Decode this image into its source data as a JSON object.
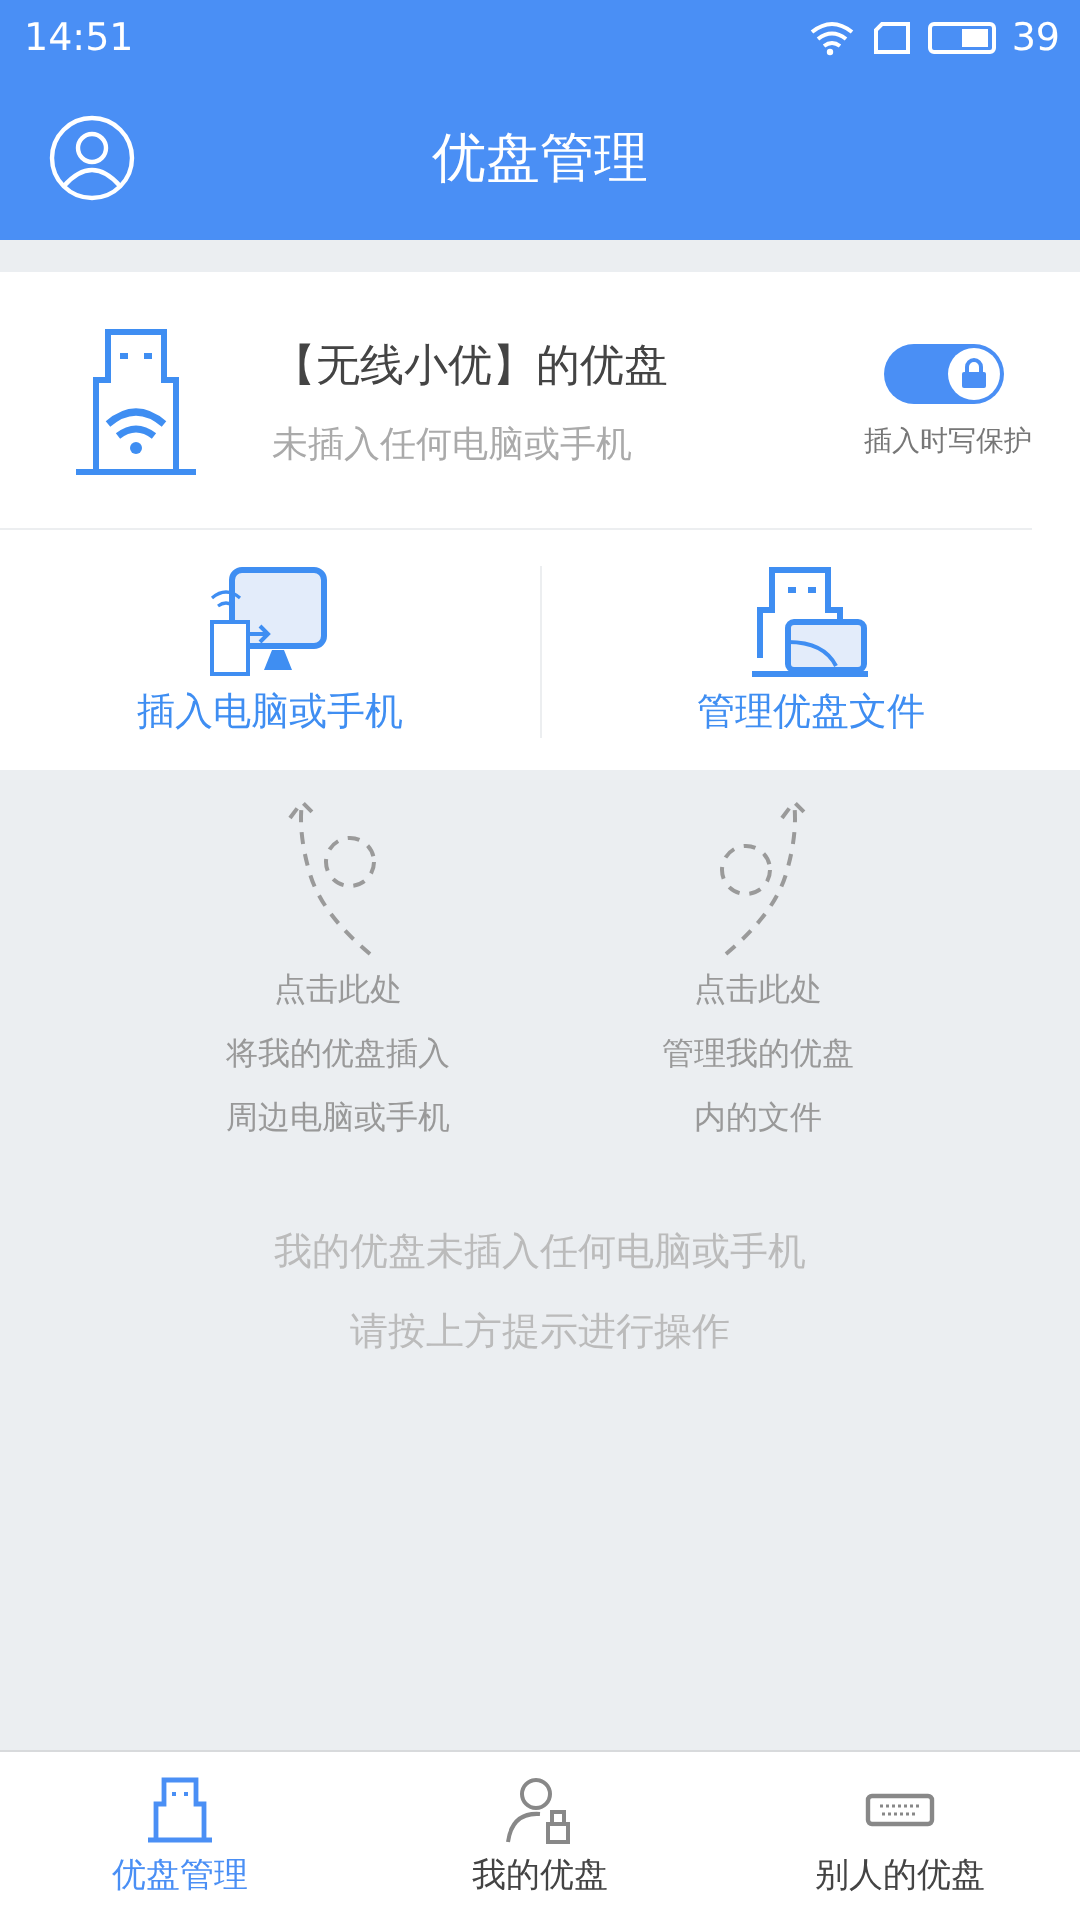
{
  "status_bar": {
    "time": "14:51",
    "battery": "39"
  },
  "header": {
    "title": "优盘管理"
  },
  "device": {
    "name": "【无线小优】的优盘",
    "status": "未插入任何电脑或手机",
    "write_protect": {
      "label": "插入时写保护",
      "on": true
    }
  },
  "actions": [
    {
      "kind": "insert",
      "label": "插入电脑或手机"
    },
    {
      "kind": "files",
      "label": "管理优盘文件"
    }
  ],
  "hints": [
    {
      "kind": "left",
      "lines": [
        "点击此处",
        "将我的优盘插入",
        "周边电脑或手机"
      ]
    },
    {
      "kind": "right",
      "lines": [
        "点击此处",
        "管理我的优盘",
        "内的文件"
      ]
    }
  ],
  "message": [
    "我的优盘未插入任何电脑或手机",
    "请按上方提示进行操作"
  ],
  "tabs": [
    {
      "kind": "manage",
      "label": "优盘管理",
      "selected": true
    },
    {
      "kind": "mine",
      "label": "我的优盘",
      "selected": false
    },
    {
      "kind": "others",
      "label": "别人的优盘",
      "selected": false
    }
  ]
}
